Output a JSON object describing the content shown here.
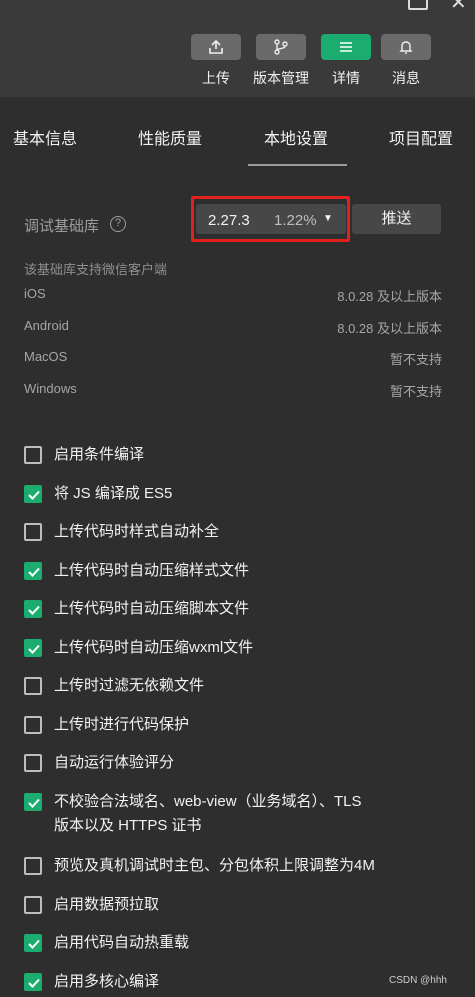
{
  "toolbar": {
    "buttons": [
      {
        "label": "上传",
        "icon": "upload-icon"
      },
      {
        "label": "版本管理",
        "icon": "branch-icon"
      },
      {
        "label": "详情",
        "icon": "menu-icon",
        "active": true,
        "color": "#1aad6f"
      },
      {
        "label": "消息",
        "icon": "bell-icon"
      }
    ]
  },
  "tabs": [
    {
      "label": "基本信息"
    },
    {
      "label": "性能质量"
    },
    {
      "label": "本地设置",
      "active": true
    },
    {
      "label": "项目配置"
    }
  ],
  "base_lib": {
    "label": "调试基础库",
    "help": "?",
    "version": "2.27.3",
    "percent": "1.22%",
    "push_label": "推送",
    "highlight_color": "#e2211c"
  },
  "support": {
    "title": "该基础库支持微信客户端",
    "platforms": [
      {
        "name": "iOS",
        "value": "8.0.28 及以上版本"
      },
      {
        "name": "Android",
        "value": "8.0.28 及以上版本"
      },
      {
        "name": "MacOS",
        "value": "暂不支持"
      },
      {
        "name": "Windows",
        "value": "暂不支持"
      }
    ]
  },
  "options": [
    {
      "label": "启用条件编译",
      "checked": false
    },
    {
      "label": "将 JS 编译成 ES5",
      "checked": true
    },
    {
      "label": "上传代码时样式自动补全",
      "checked": false
    },
    {
      "label": "上传代码时自动压缩样式文件",
      "checked": true
    },
    {
      "label": "上传代码时自动压缩脚本文件",
      "checked": true
    },
    {
      "label": "上传代码时自动压缩wxml文件",
      "checked": true
    },
    {
      "label": "上传时过滤无依赖文件",
      "checked": false
    },
    {
      "label": "上传时进行代码保护",
      "checked": false
    },
    {
      "label": "自动运行体验评分",
      "checked": false
    },
    {
      "label": "不校验合法域名、web-view（业务域名）、TLS",
      "label_line2": "版本以及 HTTPS 证书",
      "checked": true
    },
    {
      "label": "预览及真机调试时主包、分包体积上限调整为4M",
      "checked": false
    },
    {
      "label": "启用数据预拉取",
      "checked": false
    },
    {
      "label": "启用代码自动热重载",
      "checked": true
    },
    {
      "label": "启用多核心编译",
      "checked": true
    }
  ],
  "watermark": "CSDN @hhh"
}
